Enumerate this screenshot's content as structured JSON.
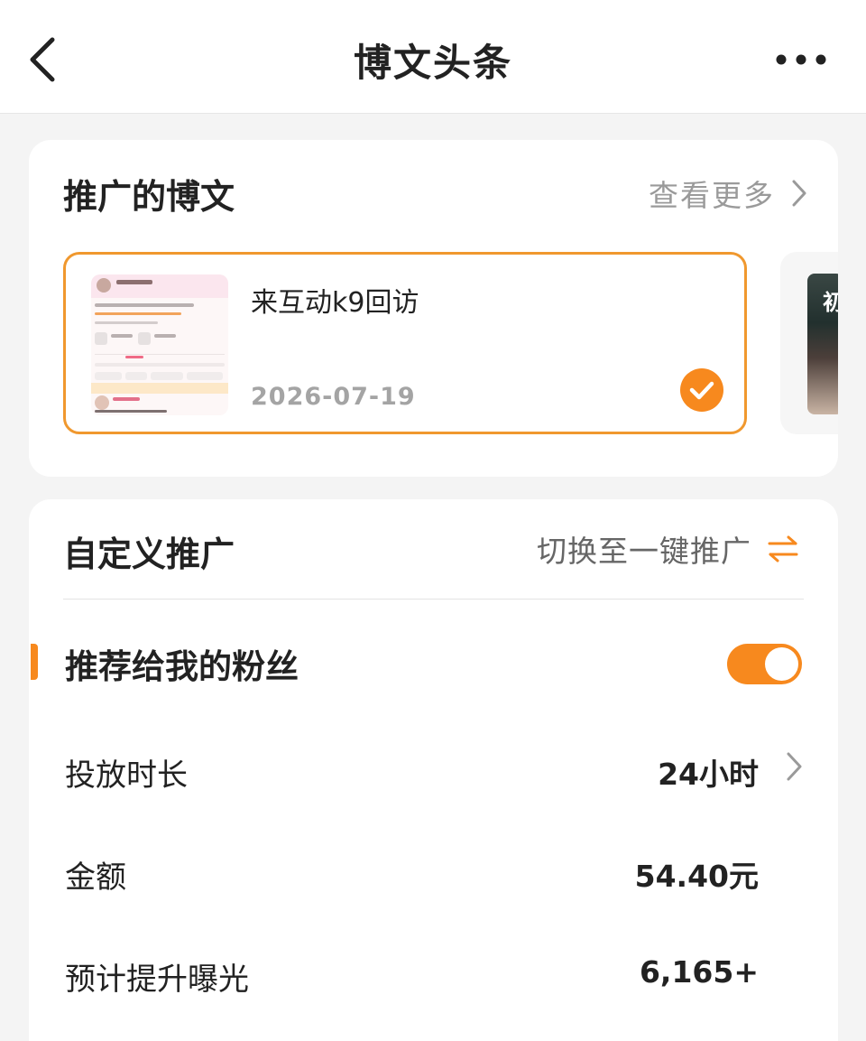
{
  "header": {
    "title": "博文头条"
  },
  "promoted_posts": {
    "section_title": "推广的博文",
    "see_more_label": "查看更多",
    "selected_post": {
      "title": "来互动k9回访",
      "date": "2026-07-19",
      "selected": true
    },
    "next_post_peek_char": "初"
  },
  "custom_promo": {
    "section_title": "自定义推广",
    "switch_label": "切换至一键推广",
    "fans_toggle": {
      "label": "推荐给我的粉丝",
      "on": true
    },
    "rows": [
      {
        "label": "投放时长",
        "value": "24小时",
        "has_chevron": true
      },
      {
        "label": "金额",
        "value": "54.40元",
        "has_chevron": false
      },
      {
        "label": "预计提升曝光",
        "value": "6,165+",
        "has_chevron": false
      }
    ]
  },
  "colors": {
    "accent": "#f7891e",
    "border_accent": "#f0982e",
    "muted_text": "#9a9a9a",
    "background": "#f4f4f4"
  },
  "icons": {
    "back": "chevron-left-icon",
    "more": "more-dots-icon",
    "see_more": "chevron-right-icon",
    "check": "check-circle-icon",
    "switch": "swap-arrows-icon"
  }
}
